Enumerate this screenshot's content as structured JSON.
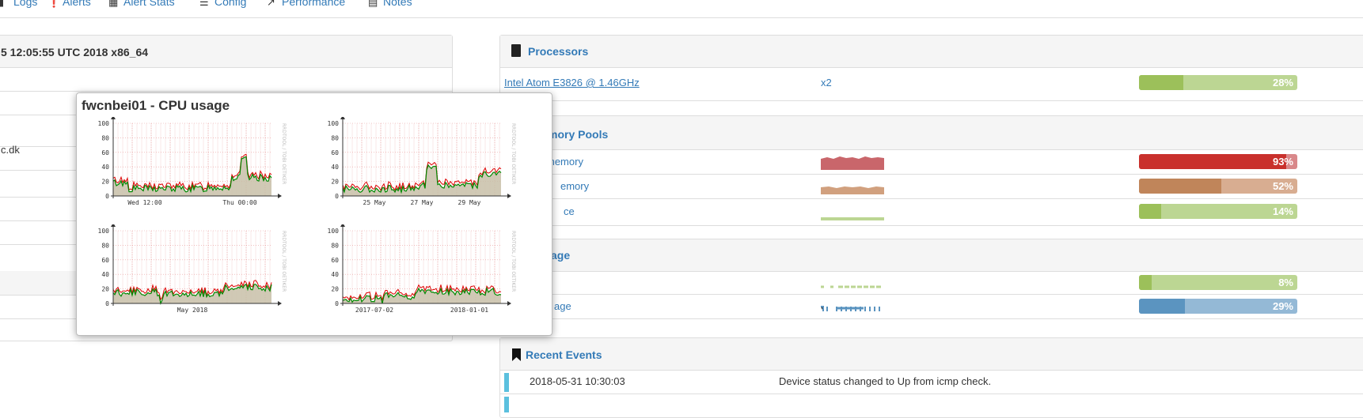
{
  "nav": {
    "items": [
      {
        "label": "Logs",
        "icon": "file-icon"
      },
      {
        "label": "Alerts",
        "icon": "exclamation-icon"
      },
      {
        "label": "Alert Stats",
        "icon": "bar-chart-icon"
      },
      {
        "label": "Config",
        "icon": "menu-icon"
      },
      {
        "label": "Performance",
        "icon": "line-chart-icon"
      },
      {
        "label": "Notes",
        "icon": "note-icon"
      }
    ]
  },
  "overview": {
    "title_fragment": "5 12:05:55 UTC 2018 x86_64",
    "domain_fragment": "c.dk"
  },
  "popup": {
    "title": "fwcnbei01 - CPU usage",
    "graphs": [
      {
        "xlabels": [
          "Wed 12:00",
          "Thu 00:00"
        ],
        "yticks": [
          0,
          20,
          40,
          60,
          80,
          100
        ],
        "watermark": "RRDTOOL / TOBI OETIKER"
      },
      {
        "xlabels": [
          "25 May",
          "27 May",
          "29 May"
        ],
        "yticks": [
          0,
          20,
          40,
          60,
          80,
          100
        ],
        "watermark": "RRDTOOL / TOBI OETIKER"
      },
      {
        "xlabels": [
          "May 2018"
        ],
        "yticks": [
          0,
          20,
          40,
          60,
          80,
          100
        ],
        "watermark": "RRDTOOL / TOBI OETIKER"
      },
      {
        "xlabels": [
          "2017-07-02",
          "2018-01-01"
        ],
        "yticks": [
          0,
          20,
          40,
          60,
          80,
          100
        ],
        "watermark": "RRDTOOL / TOBI OETIKER"
      }
    ]
  },
  "processors": {
    "title": "Processors",
    "name": "Intel Atom E3826 @ 1.46GHz",
    "count": "x2",
    "usage": {
      "label": "28%",
      "value": 28
    }
  },
  "memory": {
    "title_fragment": "mory Pools",
    "rows": [
      {
        "label": "memory",
        "usage": {
          "label": "93%",
          "value": 93
        },
        "color": "#c9302c",
        "track": "#d9888a"
      },
      {
        "label": "emory",
        "usage": {
          "label": "52%",
          "value": 52
        },
        "color": "#c0855a",
        "track": "#d8ad91"
      },
      {
        "label": "ce",
        "usage": {
          "label": "14%",
          "value": 14
        },
        "color": "#9cc05a",
        "track": "#bcd693"
      }
    ]
  },
  "storage": {
    "title_fragment": "age",
    "rows": [
      {
        "label": "",
        "usage": {
          "label": "8%",
          "value": 8
        },
        "color": "#9cc05a",
        "track": "#bcd693"
      },
      {
        "label": "age",
        "usage": {
          "label": "29%",
          "value": 29
        },
        "color": "#5b94c0",
        "track": "#94b9d6"
      }
    ]
  },
  "events": {
    "title": "Recent Events",
    "items": [
      {
        "time": "2018-05-31 10:30:03",
        "message": "Device status changed to Up from icmp check."
      }
    ]
  },
  "colors": {
    "link": "#337ab7",
    "ok_fill": "#9cc05a",
    "ok_track": "#bcd693",
    "event": "#5bc0de"
  }
}
